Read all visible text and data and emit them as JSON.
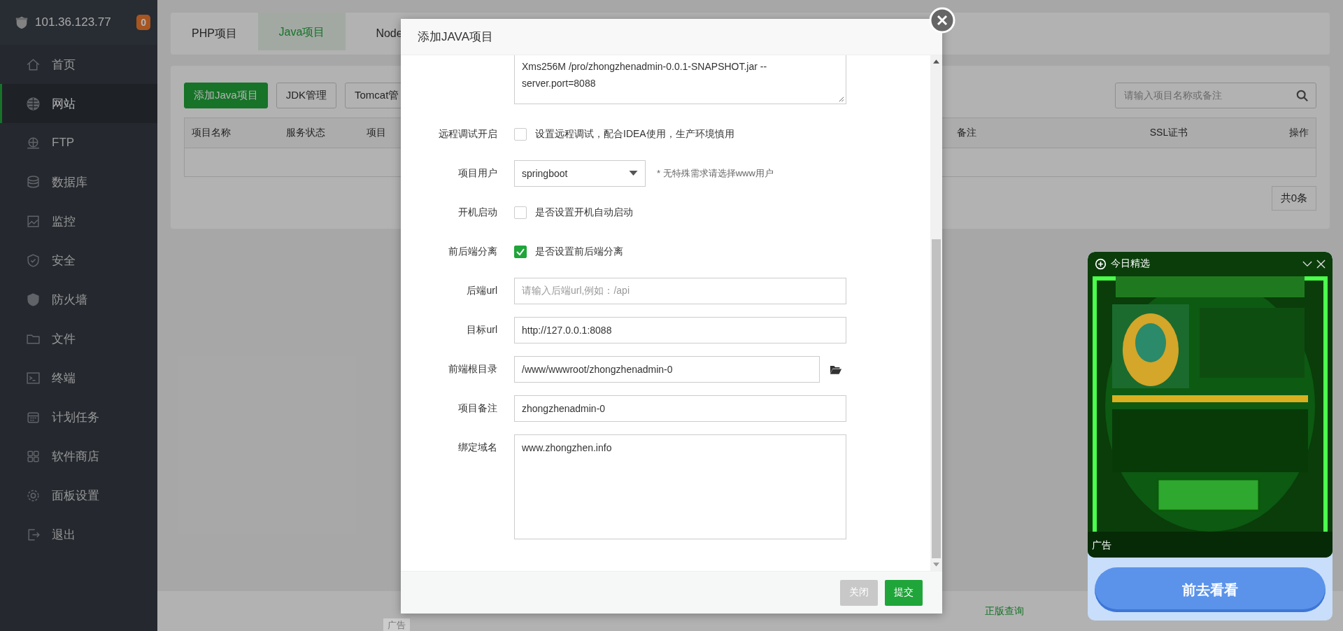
{
  "sidebar": {
    "server": "101.36.123.77",
    "badge": "0",
    "items": [
      {
        "label": "首页",
        "selected": false
      },
      {
        "label": "网站",
        "selected": true
      },
      {
        "label": "FTP",
        "selected": false
      },
      {
        "label": "数据库",
        "selected": false
      },
      {
        "label": "监控",
        "selected": false
      },
      {
        "label": "安全",
        "selected": false
      },
      {
        "label": "防火墙",
        "selected": false
      },
      {
        "label": "文件",
        "selected": false
      },
      {
        "label": "终端",
        "selected": false
      },
      {
        "label": "计划任务",
        "selected": false
      },
      {
        "label": "软件商店",
        "selected": false
      },
      {
        "label": "面板设置",
        "selected": false
      },
      {
        "label": "退出",
        "selected": false
      }
    ]
  },
  "tabs": [
    {
      "label": "PHP项目",
      "selected": false
    },
    {
      "label": "Java项目",
      "selected": true
    },
    {
      "label": "Node",
      "selected": false
    }
  ],
  "toolbar": {
    "buttons": [
      {
        "label": "添加Java项目",
        "kind": "primary"
      },
      {
        "label": "JDK管理",
        "kind": "plain"
      },
      {
        "label": "Tomcat管",
        "kind": "plain"
      }
    ],
    "search": {
      "placeholder": "请输入项目名称或备注"
    }
  },
  "table": {
    "columns": [
      "项目名称",
      "服务状态",
      "项目",
      "备注",
      "SSL证书",
      "操作"
    ]
  },
  "pagination": "共0条",
  "footer": {
    "links": [
      "正版查询"
    ],
    "ad_tag": "广告"
  },
  "dialog": {
    "title": "添加JAVA项目",
    "fields": [
      {
        "kind": "command",
        "value": "Xms256M  /pro/zhongzhenadmin-0.0.1-SNAPSHOT.jar --server.port=8088"
      },
      {
        "kind": "checkbox",
        "label": "远程调试开启",
        "text": "设置远程调试，配合IDEA使用，生产环境慎用",
        "checked": false
      },
      {
        "kind": "select",
        "label": "项目用户",
        "value": "springboot",
        "hint": "* 无特殊需求请选择www用户"
      },
      {
        "kind": "checkbox",
        "label": "开机启动",
        "text": "是否设置开机自动启动",
        "checked": false
      },
      {
        "kind": "checkbox",
        "label": "前后端分离",
        "text": "是否设置前后端分离",
        "checked": true
      },
      {
        "kind": "input",
        "label": "后端url",
        "placeholder": "请输入后端url,例如：/api"
      },
      {
        "kind": "input",
        "label": "目标url",
        "value": "http://127.0.0.1:8088"
      },
      {
        "kind": "path",
        "label": "前端根目录",
        "value": "/www/wwwroot/zhongzhenadmin-0"
      },
      {
        "kind": "input",
        "label": "项目备注",
        "value": "zhongzhenadmin-0"
      },
      {
        "kind": "textarea",
        "label": "绑定域名",
        "value": "www.zhongzhen.info"
      }
    ],
    "buttons": [
      {
        "label": "关闭",
        "kind": "close"
      },
      {
        "label": "提交",
        "kind": "submit"
      }
    ]
  },
  "ad": {
    "title": "今日精选",
    "tag": "广告",
    "button": "前去看看"
  }
}
